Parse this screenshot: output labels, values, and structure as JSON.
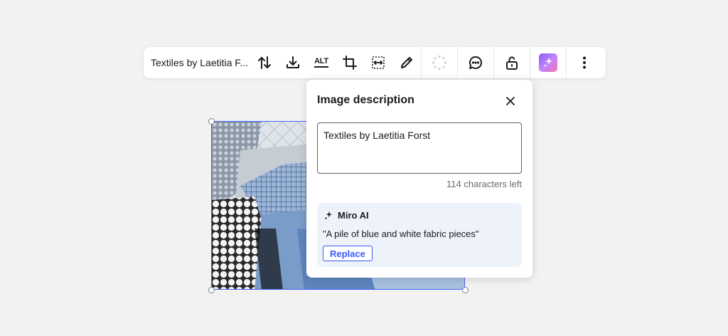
{
  "toolbar": {
    "title": "Textiles by Laetitia F...",
    "alt_label": "ALT",
    "icons": [
      "swap-vertical-icon",
      "download-icon",
      "alt-text-icon",
      "crop-icon",
      "fit-frame-icon",
      "pencil-icon",
      "loading-spinner-icon",
      "comment-icon",
      "unlock-icon",
      "ai-sparkle-icon",
      "more-vertical-icon"
    ],
    "ai_gradient": [
      "#8b5cf6",
      "#f472b6"
    ]
  },
  "popover": {
    "title": "Image description",
    "description_value": "Textiles by Laetitia Forst",
    "chars_left": "114 characters left",
    "ai": {
      "label": "Miro AI",
      "suggestion": "\"A pile of blue and white fabric pieces\"",
      "replace_label": "Replace"
    }
  },
  "colors": {
    "accent": "#3859ff",
    "selection": "#4262ff",
    "ai_card_bg": "#eef2fb",
    "canvas_bg": "#f2f2f2"
  }
}
